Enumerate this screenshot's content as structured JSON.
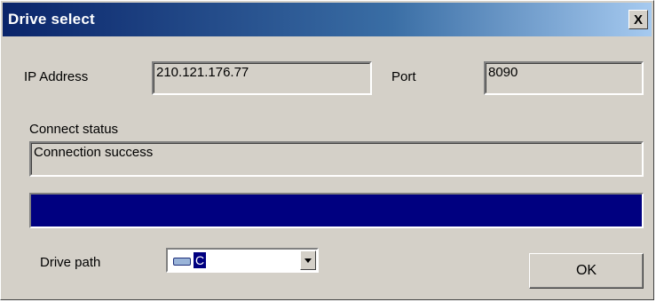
{
  "window": {
    "title": "Drive select",
    "close_symbol": "X"
  },
  "connection": {
    "ip_label": "IP Address",
    "ip_value": "210.121.176.77",
    "port_label": "Port",
    "port_value": "8090",
    "status_label": "Connect status",
    "status_value": "Connection success"
  },
  "progress": {
    "fraction": 1.0,
    "color": "#000080"
  },
  "drive": {
    "label": "Drive path",
    "selected_letter": "C",
    "icon": "drive-icon"
  },
  "buttons": {
    "ok_label": "OK"
  },
  "colors": {
    "title_gradient_start": "#0a246a",
    "title_gradient_end": "#a6caf0",
    "dialog_bg": "#d4d0c8"
  }
}
